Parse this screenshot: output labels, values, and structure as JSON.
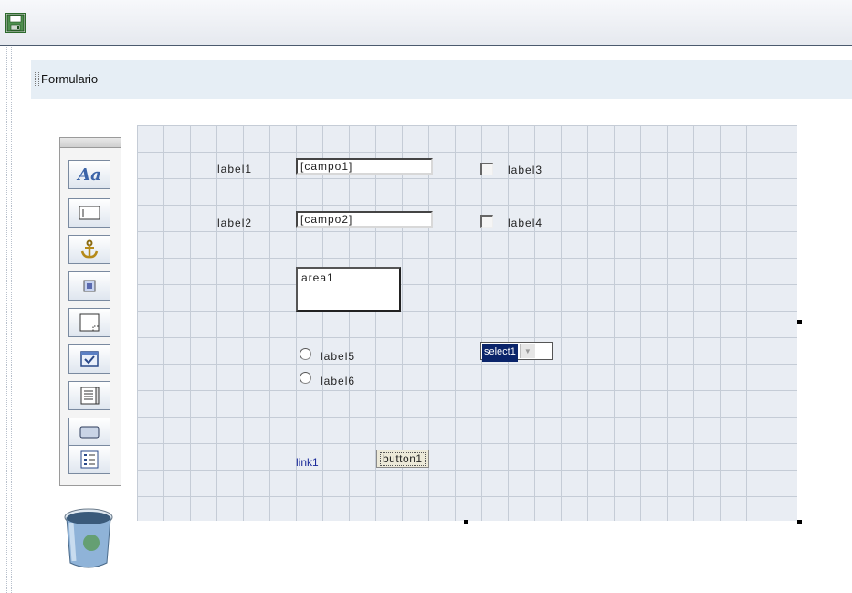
{
  "toolbar": {
    "save_icon": "floppy-disk-icon"
  },
  "section": {
    "title": "Formulario"
  },
  "palette": {
    "tools": [
      {
        "name": "label-tool",
        "icon": "text-aa-icon",
        "glyph": "Aa"
      },
      {
        "name": "textfield-tool",
        "icon": "textfield-icon"
      },
      {
        "name": "anchor-tool",
        "icon": "anchor-icon"
      },
      {
        "name": "image-tool",
        "icon": "picture-icon"
      },
      {
        "name": "textarea-tool",
        "icon": "textarea-icon"
      },
      {
        "name": "checkbox-tool",
        "icon": "checkbox-icon"
      },
      {
        "name": "list-tool",
        "icon": "list-icon"
      },
      {
        "name": "button-tool",
        "icon": "button-icon"
      },
      {
        "name": "select-tool",
        "icon": "select-list-icon"
      }
    ],
    "trash_icon": "trash-bin-icon"
  },
  "form": {
    "label1": "label1",
    "label2": "label2",
    "campo1": "[campo1]",
    "campo2": "[campo2]",
    "label3": "label3",
    "label4": "label4",
    "area1": "area1",
    "label5": "label5",
    "label6": "label6",
    "select1": "select1",
    "link1": "link1",
    "button1": "button1"
  }
}
